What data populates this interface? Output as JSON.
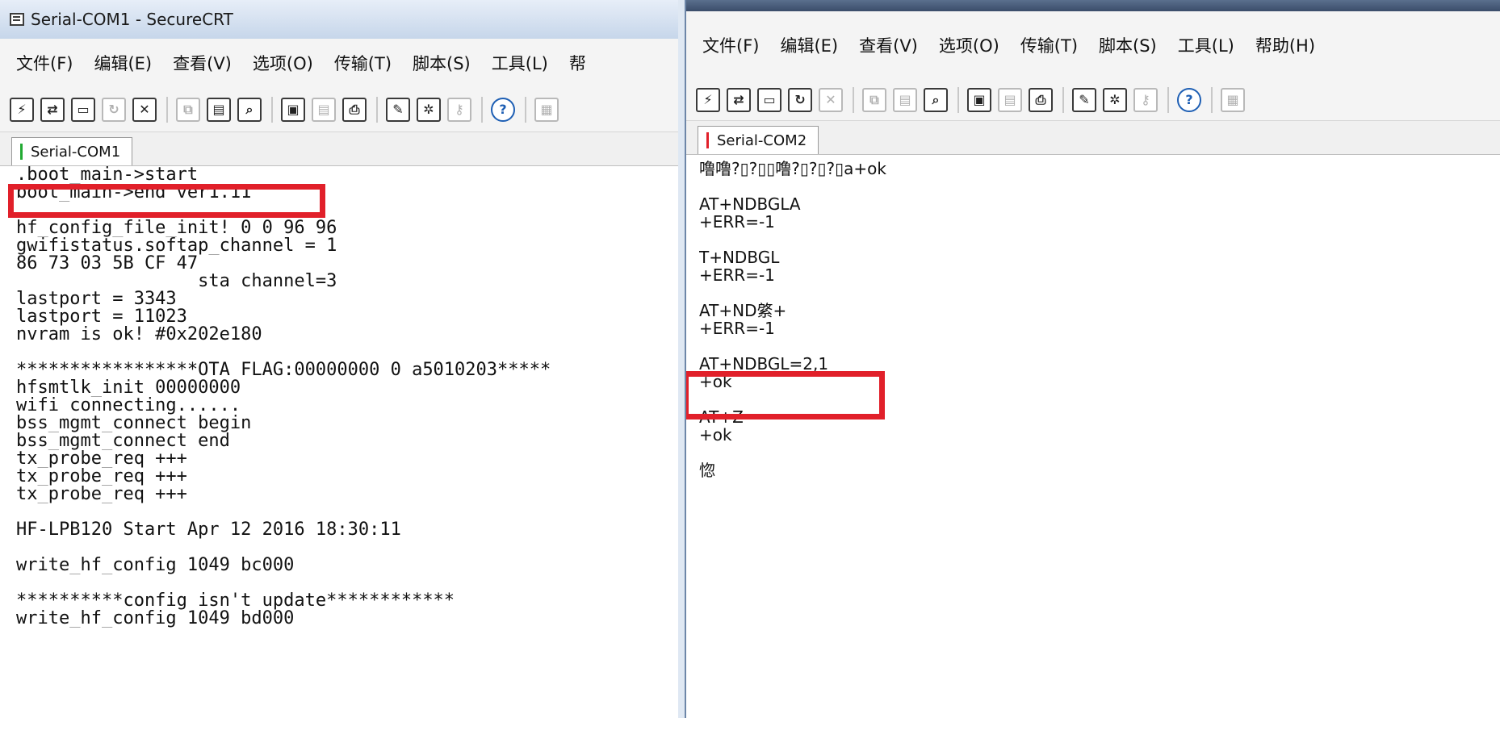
{
  "colors": {
    "highlight": "#e1202a",
    "tab_mark_1": "#22aa33",
    "tab_mark_2": "#e1202a"
  },
  "window1": {
    "title": "Serial-COM1 - SecureCRT",
    "menu": [
      "文件(F)",
      "编辑(E)",
      "查看(V)",
      "选项(O)",
      "传输(T)",
      "脚本(S)",
      "工具(L)",
      "帮"
    ],
    "toolbar_icons": [
      "connect-icon",
      "quick-connect-icon",
      "connect-tab-icon",
      "reconnect-icon",
      "disconnect-icon",
      "copy-icon",
      "paste-icon",
      "find-icon",
      "print-setup-icon",
      "print-icon",
      "printer-icon",
      "session-options-icon",
      "settings-icon",
      "keymap-icon",
      "help-icon",
      "window-icon"
    ],
    "tab": "Serial-COM1",
    "lines": [
      ".boot_main->start",
      "boot_main->end ver1.11",
      "",
      "hf_config_file_init! 0 0 96 96",
      "gwifistatus.softap_channel = 1",
      "86 73 03 5B CF 47",
      "                 sta channel=3",
      "lastport = 3343",
      "lastport = 11023",
      "nvram is ok! #0x202e180",
      "",
      "*****************OTA FLAG:00000000 0 a5010203*****",
      "hfsmtlk_init 00000000",
      "wifi connecting......",
      "bss_mgmt_connect begin",
      "bss_mgmt_connect end",
      "tx_probe_req +++",
      "tx_probe_req +++",
      "tx_probe_req +++",
      "",
      "HF-LPB120 Start Apr 12 2016 18:30:11",
      "",
      "write_hf_config 1049 bc000",
      "",
      "**********config isn't update************",
      "write_hf_config 1049 bd000"
    ]
  },
  "window2": {
    "menu": [
      "文件(F)",
      "编辑(E)",
      "查看(V)",
      "选项(O)",
      "传输(T)",
      "脚本(S)",
      "工具(L)",
      "帮助(H)"
    ],
    "tab": "Serial-COM2",
    "lines": [
      "噜噜?▯?▯▯噜?▯?▯?▯a+ok",
      "",
      "AT+NDBGLA",
      "+ERR=-1",
      "",
      "T+NDBGL",
      "+ERR=-1",
      "",
      "AT+ND綮+",
      "+ERR=-1",
      "",
      "AT+NDBGL=2,1",
      "+ok",
      "",
      "AT+Z",
      "+ok",
      "",
      "惚"
    ]
  }
}
